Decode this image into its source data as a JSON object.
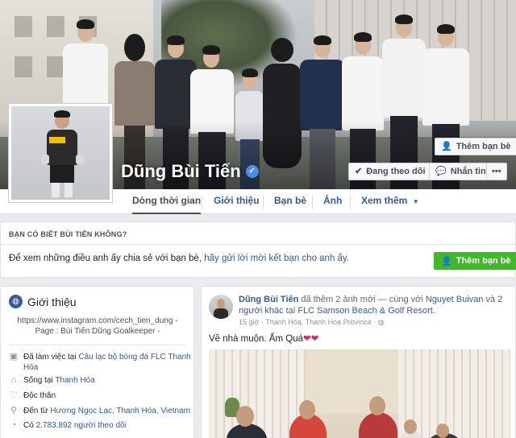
{
  "profile": {
    "name": "Dũng Bùi Tiến",
    "add_friend_cover_label": "Thêm bạn bè",
    "following_label": "Đang theo dõi",
    "message_label": "Nhắn tin"
  },
  "nav": {
    "tabs": [
      {
        "label": "Dòng thời gian"
      },
      {
        "label": "Giới thiệu"
      },
      {
        "label": "Bạn bè"
      },
      {
        "label": "Ảnh"
      },
      {
        "label": "Xem thêm"
      }
    ]
  },
  "know_box": {
    "title": "BẠN CÓ BIẾT BÙI TIẾN KHÔNG?",
    "text_prefix": "Để xem những điều anh ấy chia sẻ với bạn bè,",
    "text_link": "hãy gửi lời mời kết bạn cho anh ấy.",
    "button_label": "Thêm bạn bè"
  },
  "intro": {
    "title": "Giới thiệu",
    "bio": "https://www.instagram.com/cech_tien_dung - Page : Bùi Tiến Dũng Goalkeeper -",
    "work_prefix": "Đã làm việc tại",
    "work_link": "Câu lạc bộ bóng đá FLC Thanh Hóa",
    "lives_prefix": "Sống tại",
    "lives_link": "Thanh Hóa",
    "relationship": "Độc thân",
    "from_prefix": "Đến từ",
    "from_link": "Hương Ngọc Lạc, Thanh Hóa, Vietnam",
    "followers_prefix": "Có",
    "followers_link": "2.783.892 người theo dõi"
  },
  "post": {
    "author": "Dũng Bùi Tiến",
    "action": "đã thêm 2 ảnh mới — cùng với",
    "tag1": "Nguyet Buivan",
    "and": "và",
    "tag2": "2 người khác",
    "at": "tại",
    "place": "FLC Samson Beach & Golf Resort",
    "time": "15 giờ",
    "location": "Thanh Hóa, Thanh Hóa Province",
    "text": "Về nhà muộn. Ấm Quá",
    "hearts": "❤❤"
  }
}
